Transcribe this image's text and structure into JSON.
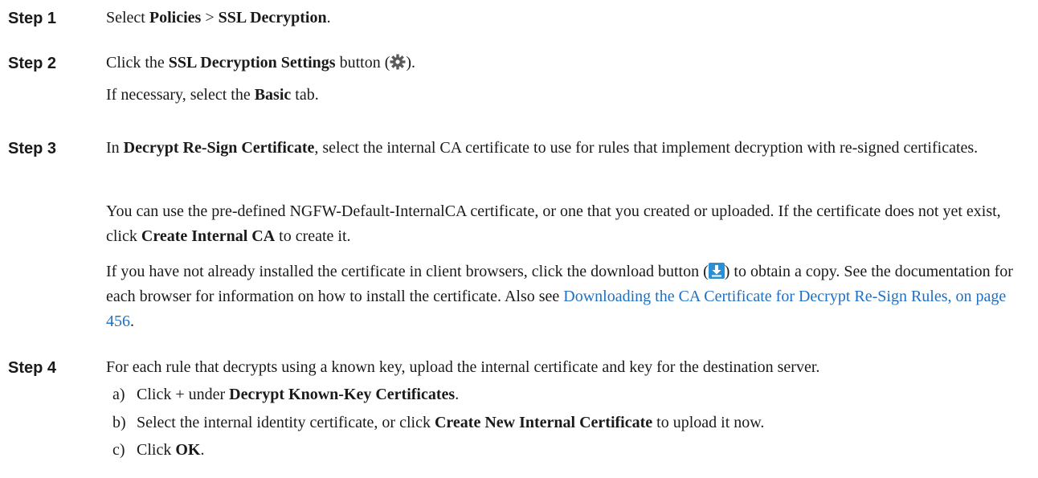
{
  "steps": [
    {
      "label": "Step 1"
    },
    {
      "label": "Step 2"
    },
    {
      "label": "Step 3"
    },
    {
      "label": "Step 4"
    }
  ],
  "s1": {
    "t1": "Select ",
    "b1": "Policies",
    "t2": " > ",
    "b2": "SSL Decryption",
    "t3": "."
  },
  "s2": {
    "t1": "Click the ",
    "b1": "SSL Decryption Settings",
    "t2": " button (",
    "t3": ").",
    "p2_t1": "If necessary, select the ",
    "p2_b1": "Basic",
    "p2_t2": " tab."
  },
  "s3": {
    "t1": "In ",
    "b1": "Decrypt Re-Sign Certificate",
    "t2": ", select the internal CA certificate to use for rules that implement decryption with re-signed certificates.",
    "p2_t1": "You can use the pre-defined NGFW-Default-InternalCA certificate, or one that you created or uploaded. If the certificate does not yet exist, click ",
    "p2_b1": "Create Internal CA",
    "p2_t2": " to create it.",
    "p3_t1": "If you have not already installed the certificate in client browsers, click the download button (",
    "p3_t2": ") to obtain a copy. See the documentation for each browser for information on how to install the certificate. Also see ",
    "p3_link": "Downloading the CA Certificate for Decrypt Re-Sign Rules, on page 456",
    "p3_t3": "."
  },
  "s4": {
    "t1": "For each rule that decrypts using a known key, upload the internal certificate and key for the destination server.",
    "a_letter": "a)",
    "a_t1": "Click + under ",
    "a_b1": "Decrypt Known-Key Certificates",
    "a_t2": ".",
    "b_letter": "b)",
    "b_t1": "Select the internal identity certificate, or click ",
    "b_b1": "Create New Internal Certificate",
    "b_t2": " to upload it now.",
    "c_letter": "c)",
    "c_t1": "Click ",
    "c_b1": "OK",
    "c_t2": "."
  },
  "icons": {
    "settings": "gear-icon",
    "download": "download-icon"
  }
}
